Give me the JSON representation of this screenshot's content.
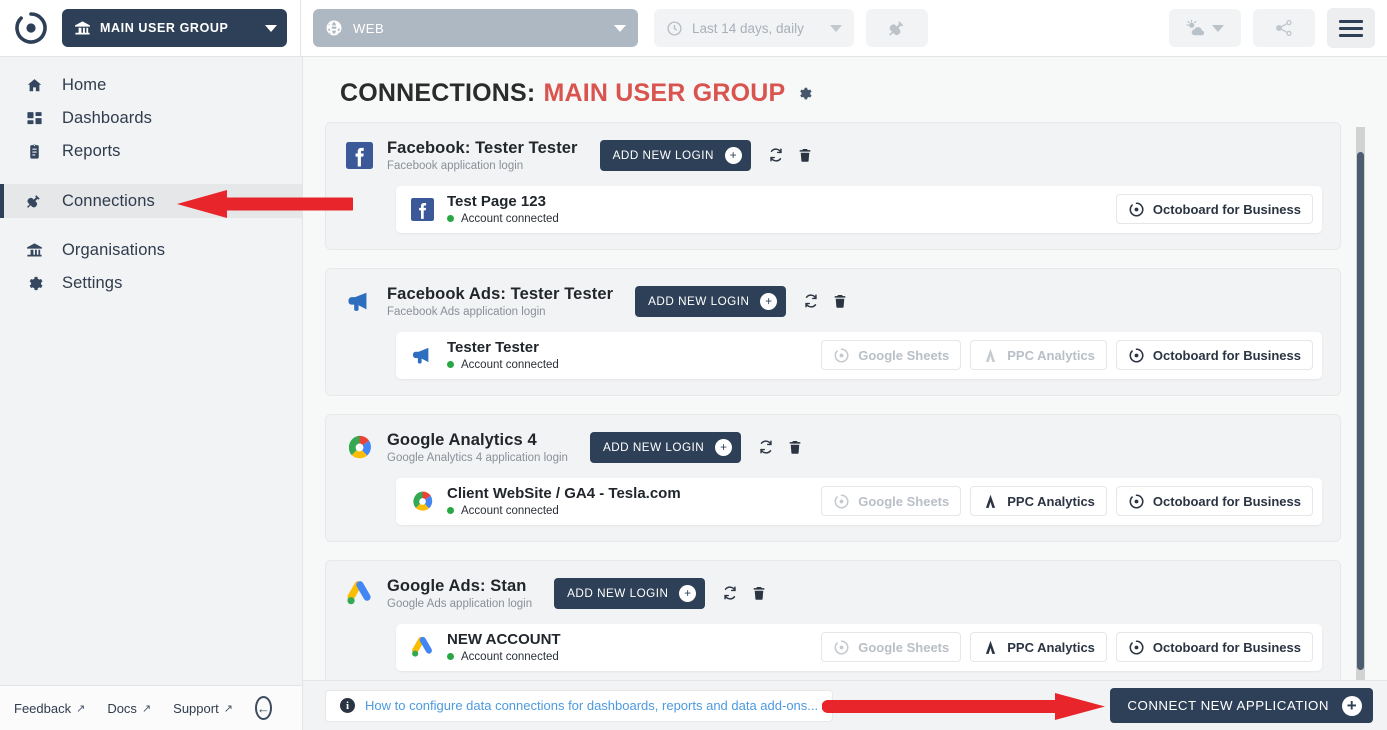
{
  "topbar": {
    "logo_icon": "octoboard-logo-icon",
    "group_selector": {
      "icon": "bank-icon",
      "label": "MAIN USER GROUP",
      "caret": "chevron-down-icon"
    },
    "web_selector": {
      "icon": "globe-icon",
      "label": "WEB",
      "caret": "chevron-down-icon"
    },
    "date_selector": {
      "icon": "clock-icon",
      "label": "Last 14 days, daily",
      "caret": "chevron-down-icon"
    },
    "plug_button": {
      "icon": "plug-icon"
    },
    "weather_button": {
      "icon": "weather-sun-cloud-icon",
      "caret": "chevron-down-icon"
    },
    "share_button": {
      "icon": "share-icon"
    },
    "menu_button": {
      "icon": "hamburger-menu-icon"
    }
  },
  "sidebar": {
    "items": [
      {
        "label": "Home",
        "icon": "home-icon",
        "active": false
      },
      {
        "label": "Dashboards",
        "icon": "dashboard-grid-icon",
        "active": false
      },
      {
        "label": "Reports",
        "icon": "clipboard-icon",
        "active": false
      },
      {
        "label": "Connections",
        "icon": "plug-icon",
        "active": true
      },
      {
        "label": "Organisations",
        "icon": "bank-icon",
        "active": false
      },
      {
        "label": "Settings",
        "icon": "gear-icon",
        "active": false
      }
    ],
    "footer": {
      "feedback": "Feedback",
      "docs": "Docs",
      "support": "Support",
      "external_glyph": "↗",
      "collapse": "←"
    }
  },
  "page": {
    "title_prefix": "CONNECTIONS:",
    "title_group": "MAIN USER GROUP",
    "title_gear_icon": "gear-icon"
  },
  "connections": [
    {
      "logo": "facebook-icon",
      "title": "Facebook: Tester Tester",
      "subtitle": "Facebook application login",
      "add_login_label": "ADD NEW LOGIN",
      "refresh_icon": "refresh-icon",
      "delete_icon": "trash-icon",
      "accounts": [
        {
          "logo": "facebook-icon",
          "name": "Test Page 123",
          "status": "Account connected",
          "pills": [
            {
              "label": "Octoboard for Business",
              "icon": "octoboard-icon",
              "enabled": true
            }
          ]
        }
      ]
    },
    {
      "logo": "facebook-ads-icon",
      "title": "Facebook Ads: Tester Tester",
      "subtitle": "Facebook Ads application login",
      "add_login_label": "ADD NEW LOGIN",
      "refresh_icon": "refresh-icon",
      "delete_icon": "trash-icon",
      "accounts": [
        {
          "logo": "facebook-ads-icon",
          "name": "Tester Tester",
          "status": "Account connected",
          "pills": [
            {
              "label": "Google Sheets",
              "icon": "octoboard-icon",
              "enabled": false
            },
            {
              "label": "PPC Analytics",
              "icon": "ppc-analytics-icon",
              "enabled": false
            },
            {
              "label": "Octoboard for Business",
              "icon": "octoboard-icon",
              "enabled": true
            }
          ]
        }
      ]
    },
    {
      "logo": "google-analytics-icon",
      "title": "Google Analytics 4",
      "subtitle": "Google Analytics 4 application login",
      "add_login_label": "ADD NEW LOGIN",
      "refresh_icon": "refresh-icon",
      "delete_icon": "trash-icon",
      "accounts": [
        {
          "logo": "google-analytics-icon",
          "name": "Client WebSite / GA4 - Tesla.com",
          "status": "Account connected",
          "pills": [
            {
              "label": "Google Sheets",
              "icon": "octoboard-icon",
              "enabled": false
            },
            {
              "label": "PPC Analytics",
              "icon": "ppc-analytics-icon",
              "enabled": true
            },
            {
              "label": "Octoboard for Business",
              "icon": "octoboard-icon",
              "enabled": true
            }
          ]
        }
      ]
    },
    {
      "logo": "google-ads-icon",
      "title": "Google Ads: Stan",
      "subtitle": "Google Ads application login",
      "add_login_label": "ADD NEW LOGIN",
      "refresh_icon": "refresh-icon",
      "delete_icon": "trash-icon",
      "accounts": [
        {
          "logo": "google-ads-icon",
          "name": "NEW ACCOUNT",
          "status": "Account connected",
          "pills": [
            {
              "label": "Google Sheets",
              "icon": "octoboard-icon",
              "enabled": false
            },
            {
              "label": "PPC Analytics",
              "icon": "ppc-analytics-icon",
              "enabled": true
            },
            {
              "label": "Octoboard for Business",
              "icon": "octoboard-icon",
              "enabled": true
            }
          ]
        }
      ]
    }
  ],
  "bottombar": {
    "info_icon": "info-icon",
    "info_text": "How to configure data connections for dashboards, reports and data add-ons...",
    "connect_label": "CONNECT NEW APPLICATION",
    "connect_plus_icon": "plus-circle-icon"
  },
  "annotations": {
    "arrow_color": "#e8252a",
    "arrows": [
      {
        "name": "arrow-pointing-connections",
        "direction": "left"
      },
      {
        "name": "arrow-pointing-connect-new-application",
        "direction": "right"
      }
    ]
  },
  "colors": {
    "accent_dark": "#2e4057",
    "accent_red": "#d9534f",
    "link_blue": "#4c9ae0",
    "status_green": "#28a745",
    "page_bg": "#f7f8f8",
    "sidebar_bg": "#f2f3f4"
  }
}
